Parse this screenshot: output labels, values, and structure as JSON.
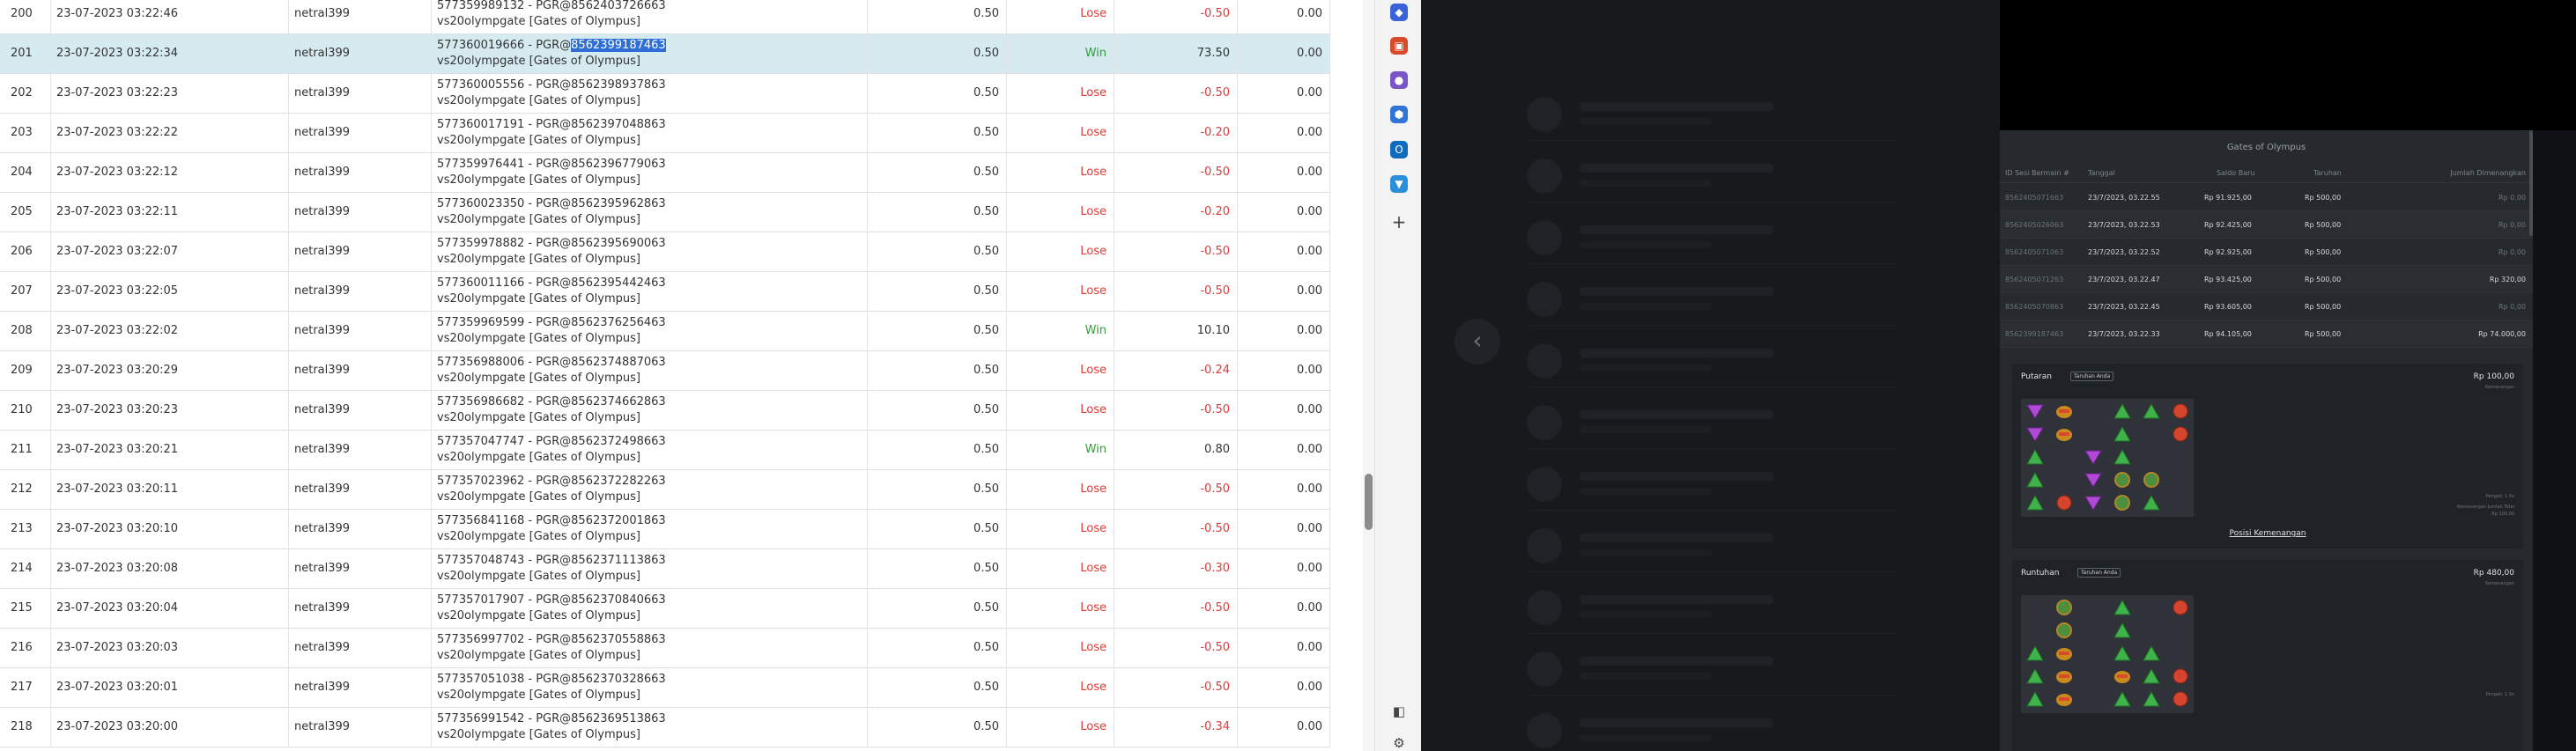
{
  "table": {
    "rows": [
      {
        "no": "200",
        "date": "23-07-2023 03:22:46",
        "user": "netral399",
        "desc1": "577359989132 - PGR@8562403726663",
        "desc2": "vs20olympgate [Gates of Olympus]",
        "bet": "0.50",
        "result": "Lose",
        "pl": "-0.50",
        "x": "0.00"
      },
      {
        "no": "201",
        "date": "23-07-2023 03:22:34",
        "user": "netral399",
        "desc1_prefix": "577360019666 - PGR@",
        "desc1_highlight": "8562399187463",
        "desc2": "vs20olympgate [Gates of Olympus]",
        "bet": "0.50",
        "result": "Win",
        "pl": "73.50",
        "x": "0.00",
        "selected": true
      },
      {
        "no": "202",
        "date": "23-07-2023 03:22:23",
        "user": "netral399",
        "desc1": "577360005556 - PGR@8562398937863",
        "desc2": "vs20olympgate [Gates of Olympus]",
        "bet": "0.50",
        "result": "Lose",
        "pl": "-0.50",
        "x": "0.00"
      },
      {
        "no": "203",
        "date": "23-07-2023 03:22:22",
        "user": "netral399",
        "desc1": "577360017191 - PGR@8562397048863",
        "desc2": "vs20olympgate [Gates of Olympus]",
        "bet": "0.50",
        "result": "Lose",
        "pl": "-0.20",
        "x": "0.00"
      },
      {
        "no": "204",
        "date": "23-07-2023 03:22:12",
        "user": "netral399",
        "desc1": "577359976441 - PGR@8562396779063",
        "desc2": "vs20olympgate [Gates of Olympus]",
        "bet": "0.50",
        "result": "Lose",
        "pl": "-0.50",
        "x": "0.00"
      },
      {
        "no": "205",
        "date": "23-07-2023 03:22:11",
        "user": "netral399",
        "desc1": "577360023350 - PGR@8562395962863",
        "desc2": "vs20olympgate [Gates of Olympus]",
        "bet": "0.50",
        "result": "Lose",
        "pl": "-0.20",
        "x": "0.00"
      },
      {
        "no": "206",
        "date": "23-07-2023 03:22:07",
        "user": "netral399",
        "desc1": "577359978882 - PGR@8562395690063",
        "desc2": "vs20olympgate [Gates of Olympus]",
        "bet": "0.50",
        "result": "Lose",
        "pl": "-0.50",
        "x": "0.00"
      },
      {
        "no": "207",
        "date": "23-07-2023 03:22:05",
        "user": "netral399",
        "desc1": "577360011166 - PGR@8562395442463",
        "desc2": "vs20olympgate [Gates of Olympus]",
        "bet": "0.50",
        "result": "Lose",
        "pl": "-0.50",
        "x": "0.00"
      },
      {
        "no": "208",
        "date": "23-07-2023 03:22:02",
        "user": "netral399",
        "desc1": "577359969599 - PGR@8562376256463",
        "desc2": "vs20olympgate [Gates of Olympus]",
        "bet": "0.50",
        "result": "Win",
        "pl": "10.10",
        "x": "0.00"
      },
      {
        "no": "209",
        "date": "23-07-2023 03:20:29",
        "user": "netral399",
        "desc1": "577356988006 - PGR@8562374887063",
        "desc2": "vs20olympgate [Gates of Olympus]",
        "bet": "0.50",
        "result": "Lose",
        "pl": "-0.24",
        "x": "0.00"
      },
      {
        "no": "210",
        "date": "23-07-2023 03:20:23",
        "user": "netral399",
        "desc1": "577356986682 - PGR@8562374662863",
        "desc2": "vs20olympgate [Gates of Olympus]",
        "bet": "0.50",
        "result": "Lose",
        "pl": "-0.50",
        "x": "0.00"
      },
      {
        "no": "211",
        "date": "23-07-2023 03:20:21",
        "user": "netral399",
        "desc1": "577357047747 - PGR@8562372498663",
        "desc2": "vs20olympgate [Gates of Olympus]",
        "bet": "0.50",
        "result": "Win",
        "pl": "0.80",
        "x": "0.00"
      },
      {
        "no": "212",
        "date": "23-07-2023 03:20:11",
        "user": "netral399",
        "desc1": "577357023962 - PGR@8562372282263",
        "desc2": "vs20olympgate [Gates of Olympus]",
        "bet": "0.50",
        "result": "Lose",
        "pl": "-0.50",
        "x": "0.00"
      },
      {
        "no": "213",
        "date": "23-07-2023 03:20:10",
        "user": "netral399",
        "desc1": "577356841168 - PGR@8562372001863",
        "desc2": "vs20olympgate [Gates of Olympus]",
        "bet": "0.50",
        "result": "Lose",
        "pl": "-0.50",
        "x": "0.00"
      },
      {
        "no": "214",
        "date": "23-07-2023 03:20:08",
        "user": "netral399",
        "desc1": "577357048743 - PGR@8562371113863",
        "desc2": "vs20olympgate [Gates of Olympus]",
        "bet": "0.50",
        "result": "Lose",
        "pl": "-0.30",
        "x": "0.00"
      },
      {
        "no": "215",
        "date": "23-07-2023 03:20:04",
        "user": "netral399",
        "desc1": "577357017907 - PGR@8562370840663",
        "desc2": "vs20olympgate [Gates of Olympus]",
        "bet": "0.50",
        "result": "Lose",
        "pl": "-0.50",
        "x": "0.00"
      },
      {
        "no": "216",
        "date": "23-07-2023 03:20:03",
        "user": "netral399",
        "desc1": "577356997702 - PGR@8562370558863",
        "desc2": "vs20olympgate [Gates of Olympus]",
        "bet": "0.50",
        "result": "Lose",
        "pl": "-0.50",
        "x": "0.00"
      },
      {
        "no": "217",
        "date": "23-07-2023 03:20:01",
        "user": "netral399",
        "desc1": "577357051038 - PGR@8562370328663",
        "desc2": "vs20olympgate [Gates of Olympus]",
        "bet": "0.50",
        "result": "Lose",
        "pl": "-0.50",
        "x": "0.00"
      },
      {
        "no": "218",
        "date": "23-07-2023 03:20:00",
        "user": "netral399",
        "desc1": "577356991542 - PGR@8562369513863",
        "desc2": "vs20olympgate [Gates of Olympus]",
        "bet": "0.50",
        "result": "Lose",
        "pl": "-0.34",
        "x": "0.00"
      }
    ]
  },
  "sidebar": {
    "icons": [
      "tag-icon",
      "toolbox-icon",
      "people-icon",
      "shield-icon",
      "outlook-icon",
      "drop-icon",
      "add-icon"
    ],
    "bottom_icons": [
      "panel-toggle-icon",
      "settings-icon"
    ],
    "colors": [
      "#3b63d8",
      "#d84b2a",
      "#7a55c8",
      "#2f74d6",
      "#0f6cbd",
      "#2b8fd8"
    ]
  },
  "viewer": {
    "game_title": "Gates of Olympus",
    "history_headers": {
      "id": "ID Sesi Bermain #",
      "date": "Tanggal",
      "balance": "Saldo Baru",
      "bet": "Taruhan",
      "win": "Jumlah Dimenangkan"
    },
    "history_rows": [
      {
        "id": "8562405071663",
        "date": "23/7/2023, 03.22.55",
        "balance": "Rp 91.925,00",
        "bet": "Rp 500,00",
        "win": "Rp 0,00",
        "dim": true
      },
      {
        "id": "8562405026063",
        "date": "23/7/2023, 03.22.53",
        "balance": "Rp 92.425,00",
        "bet": "Rp 500,00",
        "win": "Rp 0,00",
        "dim": true
      },
      {
        "id": "8562405071063",
        "date": "23/7/2023, 03.22.52",
        "balance": "Rp 92.925,00",
        "bet": "Rp 500,00",
        "win": "Rp 0,00",
        "dim": true
      },
      {
        "id": "8562405071263",
        "date": "23/7/2023, 03.22.47",
        "balance": "Rp 93.425,00",
        "bet": "Rp 500,00",
        "win": "Rp 320,00",
        "dim": false
      },
      {
        "id": "8562405070863",
        "date": "23/7/2023, 03.22.45",
        "balance": "Rp 93.605,00",
        "bet": "Rp 500,00",
        "win": "Rp 0,00",
        "dim": true
      },
      {
        "id": "8562399187463",
        "date": "23/7/2023, 03.22.33",
        "balance": "Rp 94.105,00",
        "bet": "Rp 500,00",
        "win": "Rp 74.000,00",
        "dim": false
      }
    ],
    "spin1": {
      "title": "Putaran",
      "badge": "Taruhan Anda",
      "amount": "Rp 100,00",
      "amount_sub": "Kemenangan",
      "notes": [
        "Pengali: 1 0x",
        "Kemenangan Jumlah Total",
        "Rp 100,00"
      ],
      "link": "Posisi Kemenangan"
    },
    "spin2": {
      "title": "Runtuhan",
      "badge": "Taruhan Anda",
      "amount": "Rp 480,00",
      "amount_sub": "Kemenangan",
      "notes": [
        "Pengali: 1 0x"
      ]
    }
  }
}
